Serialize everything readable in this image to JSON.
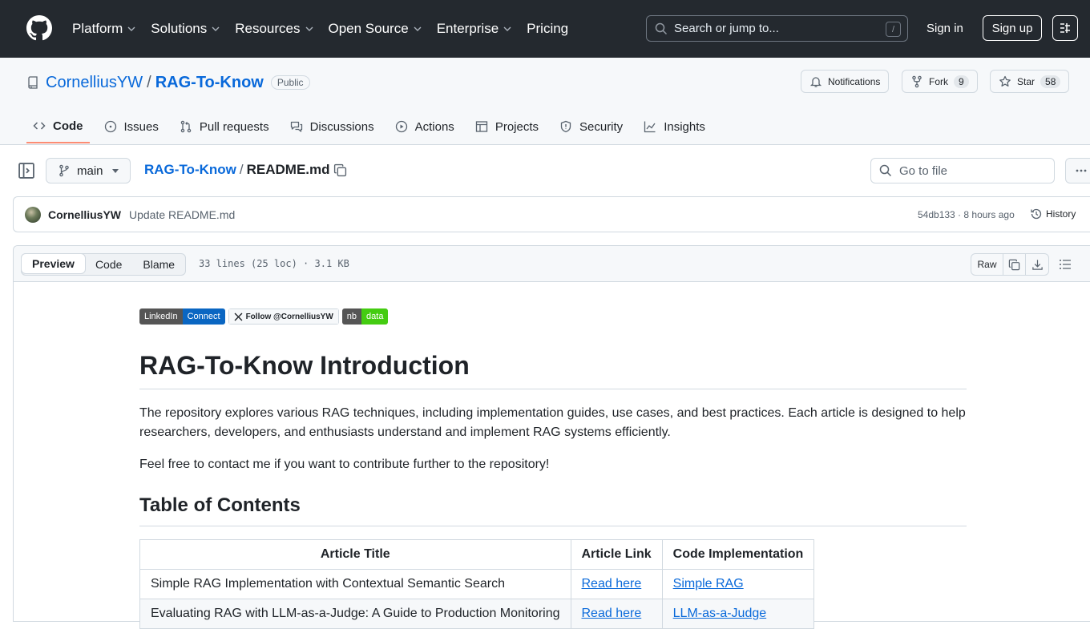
{
  "topnav": {
    "items": [
      {
        "label": "Platform",
        "has_menu": true
      },
      {
        "label": "Solutions",
        "has_menu": true
      },
      {
        "label": "Resources",
        "has_menu": true
      },
      {
        "label": "Open Source",
        "has_menu": true
      },
      {
        "label": "Enterprise",
        "has_menu": true
      },
      {
        "label": "Pricing",
        "has_menu": false
      }
    ],
    "search_placeholder": "Search or jump to...",
    "search_key": "/",
    "sign_in": "Sign in",
    "sign_up": "Sign up"
  },
  "repo": {
    "owner": "CornelliusYW",
    "separator": "/",
    "name": "RAG-To-Know",
    "visibility": "Public",
    "notifications_label": "Notifications",
    "fork_label": "Fork",
    "fork_count": "9",
    "star_label": "Star",
    "star_count": "58"
  },
  "tabs": [
    {
      "label": "Code",
      "icon": "code-icon",
      "active": true
    },
    {
      "label": "Issues",
      "icon": "issue-icon"
    },
    {
      "label": "Pull requests",
      "icon": "pull-request-icon"
    },
    {
      "label": "Discussions",
      "icon": "discussions-icon"
    },
    {
      "label": "Actions",
      "icon": "play-icon"
    },
    {
      "label": "Projects",
      "icon": "table-icon"
    },
    {
      "label": "Security",
      "icon": "shield-icon"
    },
    {
      "label": "Insights",
      "icon": "graph-icon"
    }
  ],
  "filenav": {
    "branch": "main",
    "crumb_repo": "RAG-To-Know",
    "crumb_sep": "/",
    "crumb_file": "README.md",
    "goto_placeholder": "Go to file"
  },
  "commit": {
    "author": "CornelliusYW",
    "message": "Update README.md",
    "meta": "54db133 · 8 hours ago",
    "history": "History"
  },
  "filehead": {
    "views": [
      "Preview",
      "Code",
      "Blame"
    ],
    "active_view": "Preview",
    "info": "33 lines (25 loc) · 3.1 KB",
    "raw": "Raw"
  },
  "readme": {
    "badges": [
      {
        "left": "LinkedIn",
        "right": "Connect",
        "color": "#0a66c2"
      },
      {
        "text": "Follow @CornelliusYW"
      },
      {
        "left": "nb",
        "right": "data",
        "color": "#44cc11"
      }
    ],
    "title": "RAG-To-Know Introduction",
    "intro": "The repository explores various RAG techniques, including implementation guides, use cases, and best practices. Each article is designed to help researchers, developers, and enthusiasts understand and implement RAG systems efficiently.",
    "contact": "Feel free to contact me if you want to contribute further to the repository!",
    "toc_heading": "Table of Contents",
    "table": {
      "headers": [
        "Article Title",
        "Article Link",
        "Code Implementation"
      ],
      "rows": [
        [
          "Simple RAG Implementation with Contextual Semantic Search",
          "Read here",
          "Simple RAG"
        ],
        [
          "Evaluating RAG with LLM-as-a-Judge: A Guide to Production Monitoring",
          "Read here",
          "LLM-as-a-Judge"
        ]
      ]
    }
  },
  "colors": {
    "header_bg": "#24292f",
    "link": "#0969da",
    "tab_underline": "#fd8c73",
    "border": "#d1d9e0"
  }
}
